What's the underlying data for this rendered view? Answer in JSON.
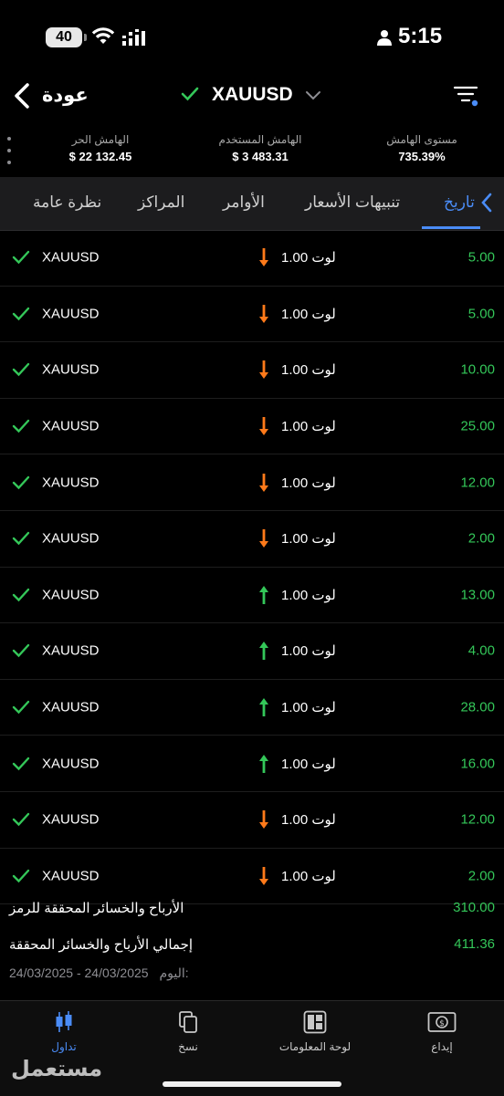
{
  "status_bar": {
    "time": "5:15",
    "battery": "40"
  },
  "header": {
    "back_label": "عودة",
    "symbol": "XAUUSD"
  },
  "margin": [
    {
      "label": "الهامش الحر",
      "value": "$ 22 132.45"
    },
    {
      "label": "الهامش المستخدم",
      "value": "$ 3 483.31"
    },
    {
      "label": "مستوى الهامش",
      "value": "735.39%"
    }
  ],
  "tabs": {
    "overview": "نظرة عامة",
    "positions": "المراكز",
    "orders": "الأوامر",
    "alerts": "تنبيهات الأسعار",
    "history": "تاريخ"
  },
  "trades": [
    {
      "symbol": "XAUUSD",
      "direction": "down",
      "lot": "1.00 لوت",
      "pnl": "5.00"
    },
    {
      "symbol": "XAUUSD",
      "direction": "down",
      "lot": "1.00 لوت",
      "pnl": "5.00"
    },
    {
      "symbol": "XAUUSD",
      "direction": "down",
      "lot": "1.00 لوت",
      "pnl": "10.00"
    },
    {
      "symbol": "XAUUSD",
      "direction": "down",
      "lot": "1.00 لوت",
      "pnl": "25.00"
    },
    {
      "symbol": "XAUUSD",
      "direction": "down",
      "lot": "1.00 لوت",
      "pnl": "12.00"
    },
    {
      "symbol": "XAUUSD",
      "direction": "down",
      "lot": "1.00 لوت",
      "pnl": "2.00"
    },
    {
      "symbol": "XAUUSD",
      "direction": "up",
      "lot": "1.00 لوت",
      "pnl": "13.00"
    },
    {
      "symbol": "XAUUSD",
      "direction": "up",
      "lot": "1.00 لوت",
      "pnl": "4.00"
    },
    {
      "symbol": "XAUUSD",
      "direction": "up",
      "lot": "1.00 لوت",
      "pnl": "28.00"
    },
    {
      "symbol": "XAUUSD",
      "direction": "up",
      "lot": "1.00 لوت",
      "pnl": "16.00"
    },
    {
      "symbol": "XAUUSD",
      "direction": "down",
      "lot": "1.00 لوت",
      "pnl": "12.00"
    },
    {
      "symbol": "XAUUSD",
      "direction": "down",
      "lot": "1.00 لوت",
      "pnl": "2.00"
    }
  ],
  "summary": {
    "symbol_pnl_label": "الأرباح والخسائر المحققة للرمز",
    "symbol_pnl_value": "310.00",
    "total_pnl_label": "إجمالي الأرباح والخسائر المحققة",
    "total_pnl_value": "411.36",
    "date_range": "24/03/2025 - 24/03/2025",
    "date_prefix": "اليوم:"
  },
  "bottom_nav": {
    "trade": "تداول",
    "copy": "نسخ",
    "dashboard": "لوحة المعلومات",
    "deposit": "إيداع"
  },
  "watermark": "مستعمل",
  "colors": {
    "accent": "#4a8cf7",
    "profit": "#34c759",
    "down_arrow": "#ff7a1a",
    "up_arrow": "#34c759"
  }
}
